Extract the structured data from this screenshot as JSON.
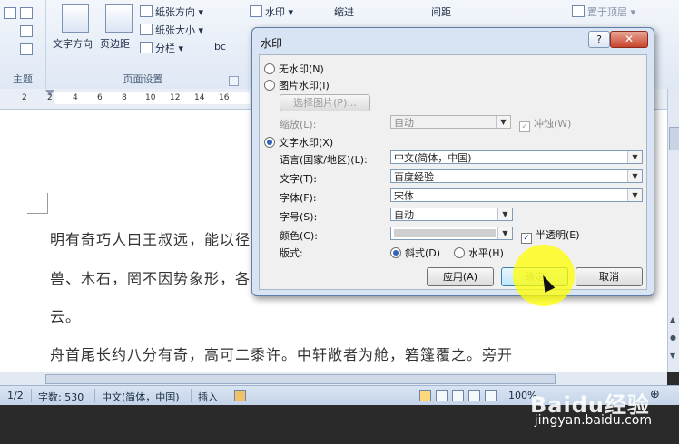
{
  "ribbon": {
    "group_theme_label": "主题",
    "group_page_setup_label": "页面设置",
    "text_direction_label": "文字方向",
    "margins_label": "页边距",
    "orientation_label": "纸张方向",
    "size_label": "纸张大小",
    "columns_label": "分栏",
    "bc_label": "bc",
    "watermark_label": "水印",
    "indent_label": "缩进",
    "spacing_label": "间距",
    "bring_front_label": "置于顶层"
  },
  "ruler": {
    "ticks": [
      "2",
      "2",
      "4",
      "6",
      "8",
      "10",
      "12",
      "14",
      "16"
    ]
  },
  "document": {
    "lines": [
      "明有奇巧人曰王叔远，能以径",
      "兽、木石，罔不因势象形，各",
      "云。",
      "舟首尾长约八分有奇，高可二黍许。中轩敞者为舱，箬篷覆之。旁开"
    ]
  },
  "status": {
    "page": "1/2",
    "words": "字数: 530",
    "language": "中文(简体，中国)",
    "mode": "插入",
    "zoom": "100%"
  },
  "dialog": {
    "title": "水印",
    "help": "?",
    "close": "✕",
    "no_watermark": "无水印(N)",
    "picture_watermark": "图片水印(I)",
    "select_picture": "选择图片(P)...",
    "scale_label": "缩放(L):",
    "scale_value": "自动",
    "washout_label": "冲蚀(W)",
    "text_watermark": "文字水印(X)",
    "language_label": "语言(国家/地区)(L):",
    "language_value": "中文(简体，中国)",
    "text_label": "文字(T):",
    "text_value": "百度经验",
    "font_label": "字体(F):",
    "font_value": "宋体",
    "size_label": "字号(S):",
    "size_value": "自动",
    "color_label": "颜色(C):",
    "semitransparent_label": "半透明(E)",
    "layout_label": "版式:",
    "diagonal_label": "斜式(D)",
    "horizontal_label": "水平(H)",
    "apply_button": "应用(A)",
    "ok_button": "确定",
    "cancel_button": "取消"
  },
  "watermark_overlay": {
    "brand": "Baidu经验",
    "url": "jingyan.baidu.com"
  }
}
